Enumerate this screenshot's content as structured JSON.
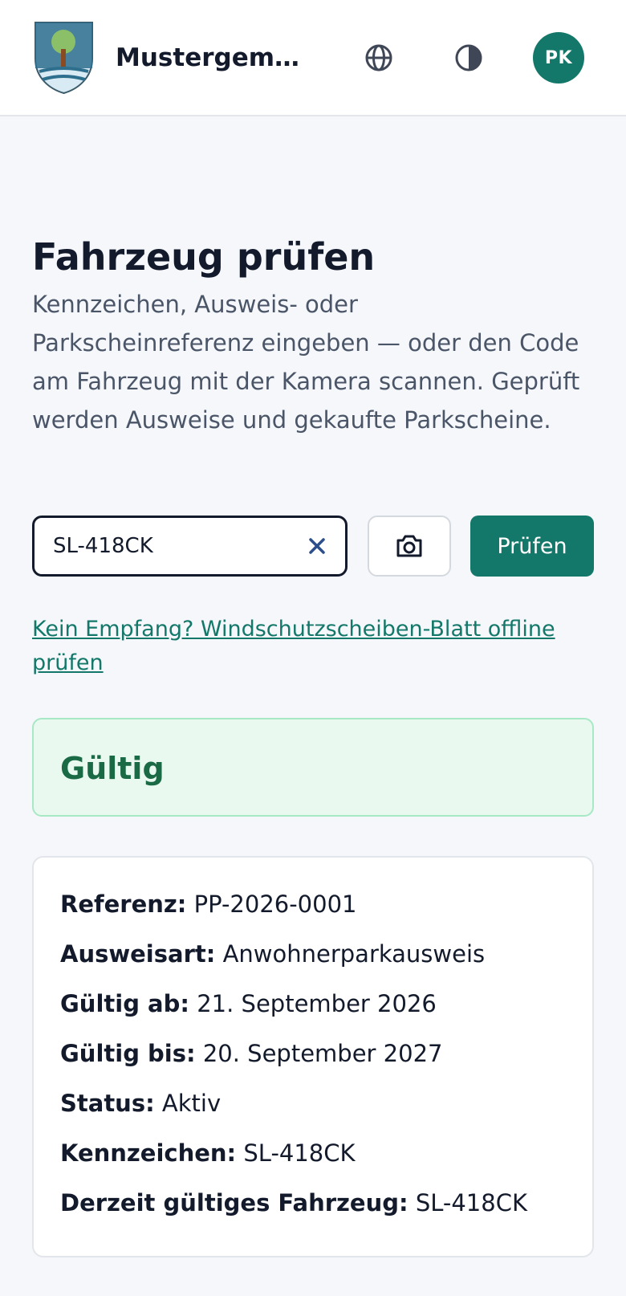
{
  "header": {
    "app_title": "Mustergemeinde",
    "avatar_initials": "PK",
    "icons": {
      "logo": "municipal-crest",
      "language": "globe-icon",
      "theme": "contrast-icon"
    }
  },
  "page": {
    "title": "Fahrzeug prüfen",
    "intro": "Kennzeichen, Ausweis- oder Parkscheinreferenz eingeben — oder den Code am Fahrzeug mit der Kamera scannen. Geprüft werden Ausweise und gekaufte Parkscheine."
  },
  "search": {
    "value": "SL-418CK",
    "clear_icon": "close-icon",
    "camera_icon": "camera-icon",
    "submit_label": "Prüfen"
  },
  "offline_link": "Kein Empfang? Windschutzscheiben-Blatt offline prüfen",
  "result": {
    "status_label": "Gültig"
  },
  "details": [
    {
      "key": "Referenz:",
      "value": "PP-2026-0001"
    },
    {
      "key": "Ausweisart:",
      "value": "Anwohnerparkausweis"
    },
    {
      "key": "Gültig ab:",
      "value": "21. September 2026"
    },
    {
      "key": "Gültig bis:",
      "value": "20. September 2027"
    },
    {
      "key": "Status:",
      "value": "Aktiv"
    },
    {
      "key": "Kennzeichen:",
      "value": "SL-418CK"
    },
    {
      "key": "Derzeit gültiges Fahrzeug:",
      "value": "SL-418CK"
    }
  ],
  "colors": {
    "primary": "#13786a",
    "success_bg": "#e9f9f0",
    "success_border": "#a7e8c5",
    "success_text": "#1a6a45",
    "text": "#131a2b",
    "muted": "#4a5568",
    "page_bg": "#f5f7fa"
  }
}
